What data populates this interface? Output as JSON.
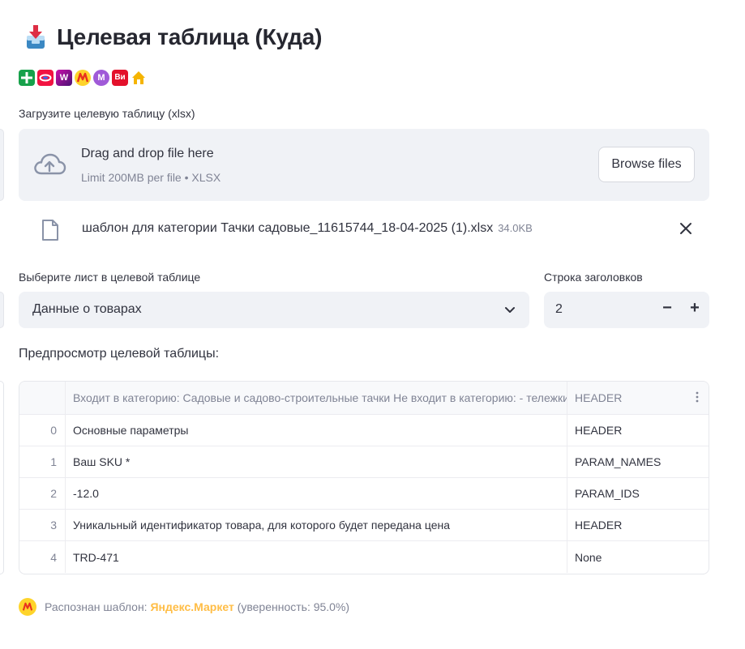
{
  "header": {
    "title": "Целевая таблица (Куда)"
  },
  "marketplace_logos": [
    {
      "name": "plus-logo",
      "glyph": "+",
      "bg": "#17a14b"
    },
    {
      "name": "ozon-logo",
      "glyph": "",
      "bg": "#f21341"
    },
    {
      "name": "wildberries-logo",
      "glyph": "W",
      "bg": "#9a1ec1"
    },
    {
      "name": "yandex-market-logo",
      "glyph": "",
      "bg": "#fed42b"
    },
    {
      "name": "megamarket-logo",
      "glyph": "M",
      "bg": "#a05ad8"
    },
    {
      "name": "vseinstrumenti-logo",
      "glyph": "Ви",
      "bg": "#e3112b"
    },
    {
      "name": "home-logo",
      "glyph": "",
      "bg": "#ffffff"
    }
  ],
  "uploader": {
    "label": "Загрузите целевую таблицу (xlsx)",
    "drop_text": "Drag and drop file here",
    "limit_text": "Limit 200MB per file • XLSX",
    "browse_label": "Browse files",
    "file_name": "шаблон для категории Тачки садовые_11615744_18-04-2025 (1).xlsx",
    "file_size": "34.0KB"
  },
  "sheet_select": {
    "label": "Выберите лист в целевой таблице",
    "value": "Данные о товарах"
  },
  "header_row": {
    "label": "Строка заголовков",
    "value": "2",
    "minus": "−",
    "plus": "+"
  },
  "preview": {
    "title": "Предпросмотр целевой таблицы:",
    "columns": [
      "Входит в категорию: Садовые и садово-строительные тачки  Не входит в категорию: - тележки",
      "HEADER"
    ],
    "rows": [
      {
        "index": "0",
        "c1": "Основные параметры",
        "c2": "HEADER"
      },
      {
        "index": "1",
        "c1": "Ваш SKU *",
        "c2": "PARAM_NAMES"
      },
      {
        "index": "2",
        "c1": "-12.0",
        "c2": "PARAM_IDS"
      },
      {
        "index": "3",
        "c1": "Уникальный идентификатор товара, для которого будет передана цена",
        "c2": "HEADER"
      },
      {
        "index": "4",
        "c1": "TRD-471",
        "c2": "None"
      }
    ]
  },
  "footer": {
    "prefix": "Распознан шаблон:",
    "brand": "Яндекс.Маркет",
    "suffix": "(уверенность: 95.0%)"
  }
}
